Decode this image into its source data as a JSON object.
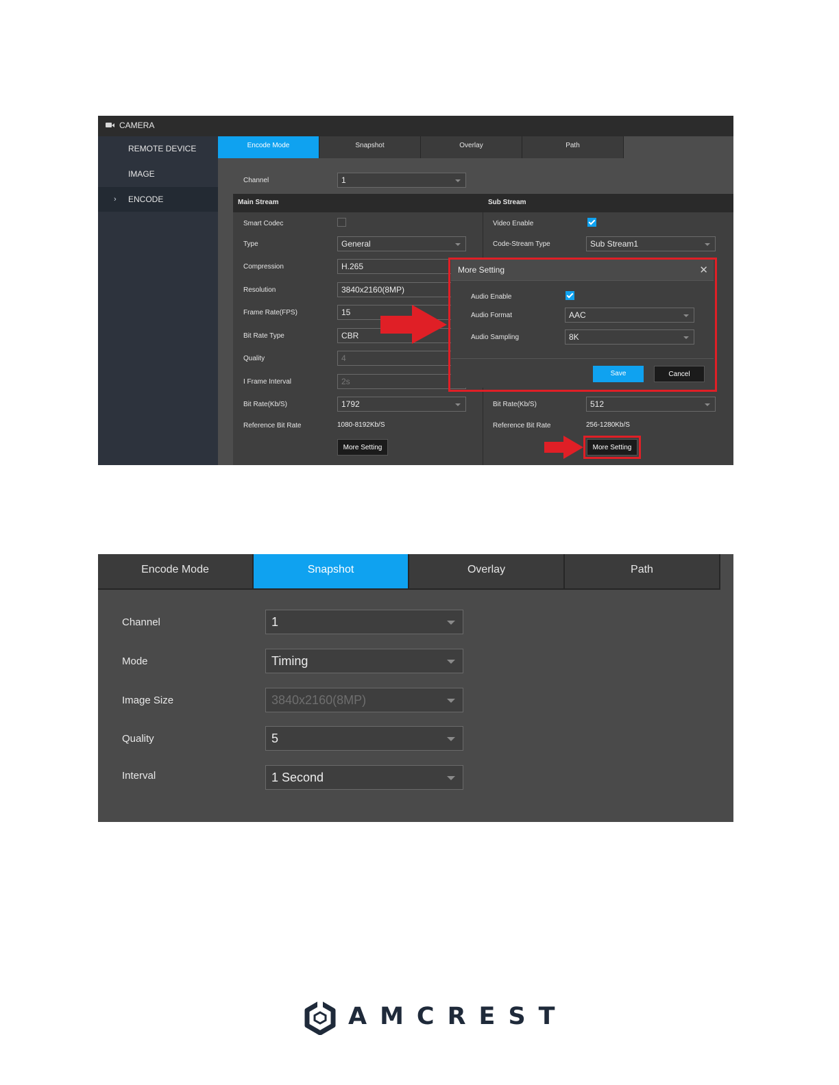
{
  "shot1": {
    "header_title": "CAMERA",
    "sidebar": [
      {
        "label": "REMOTE DEVICE",
        "active": false
      },
      {
        "label": "IMAGE",
        "active": false
      },
      {
        "label": "ENCODE",
        "active": true,
        "chevron": "›"
      }
    ],
    "tabs": [
      "Encode Mode",
      "Snapshot",
      "Overlay",
      "Path"
    ],
    "active_tab": "Encode Mode",
    "channel": {
      "label": "Channel",
      "value": "1"
    },
    "main_stream": {
      "header": "Main Stream",
      "smart_codec_label": "Smart Codec",
      "smart_codec_checked": false,
      "type_label": "Type",
      "type_value": "General",
      "compression_label": "Compression",
      "compression_value": "H.265",
      "resolution_label": "Resolution",
      "resolution_value": "3840x2160(8MP)",
      "frame_rate_label": "Frame Rate(FPS)",
      "frame_rate_value": "15",
      "bit_rate_type_label": "Bit Rate Type",
      "bit_rate_type_value": "CBR",
      "quality_label": "Quality",
      "quality_value": "4",
      "iframe_label": "I Frame Interval",
      "iframe_value": "2s",
      "bit_rate_label": "Bit Rate(Kb/S)",
      "bit_rate_value": "1792",
      "ref_label": "Reference Bit Rate",
      "ref_value": "1080-8192Kb/S",
      "more_setting": "More Setting"
    },
    "sub_stream": {
      "header": "Sub Stream",
      "video_enable_label": "Video Enable",
      "video_enable_checked": true,
      "code_stream_label": "Code-Stream Type",
      "code_stream_value": "Sub Stream1",
      "bit_rate_label": "Bit Rate(Kb/S)",
      "bit_rate_value": "512",
      "ref_label": "Reference Bit Rate",
      "ref_value": "256-1280Kb/S",
      "more_setting": "More Setting"
    },
    "modal": {
      "title": "More Setting",
      "close": "✕",
      "audio_enable_label": "Audio Enable",
      "audio_enable_checked": true,
      "audio_format_label": "Audio Format",
      "audio_format_value": "AAC",
      "audio_sampling_label": "Audio Sampling",
      "audio_sampling_value": "8K",
      "save": "Save",
      "cancel": "Cancel"
    }
  },
  "shot2": {
    "tabs": [
      "Encode Mode",
      "Snapshot",
      "Overlay",
      "Path"
    ],
    "active_tab": "Snapshot",
    "fields": [
      {
        "label": "Channel",
        "value": "1",
        "disabled": false
      },
      {
        "label": "Mode",
        "value": "Timing",
        "disabled": false
      },
      {
        "label": "Image Size",
        "value": "3840x2160(8MP)",
        "disabled": true
      },
      {
        "label": "Quality",
        "value": "5",
        "disabled": false
      },
      {
        "label": "Interval",
        "value": "1 Second",
        "disabled": false
      }
    ]
  },
  "logo": {
    "wordmark": "AMCREST"
  },
  "colors": {
    "accent_blue": "#0fa2f0",
    "highlight_red": "#e01f26",
    "panel_dark": "#4d4d4d",
    "sidebar": "#2d333d",
    "logo_navy": "#1f2a3a"
  }
}
